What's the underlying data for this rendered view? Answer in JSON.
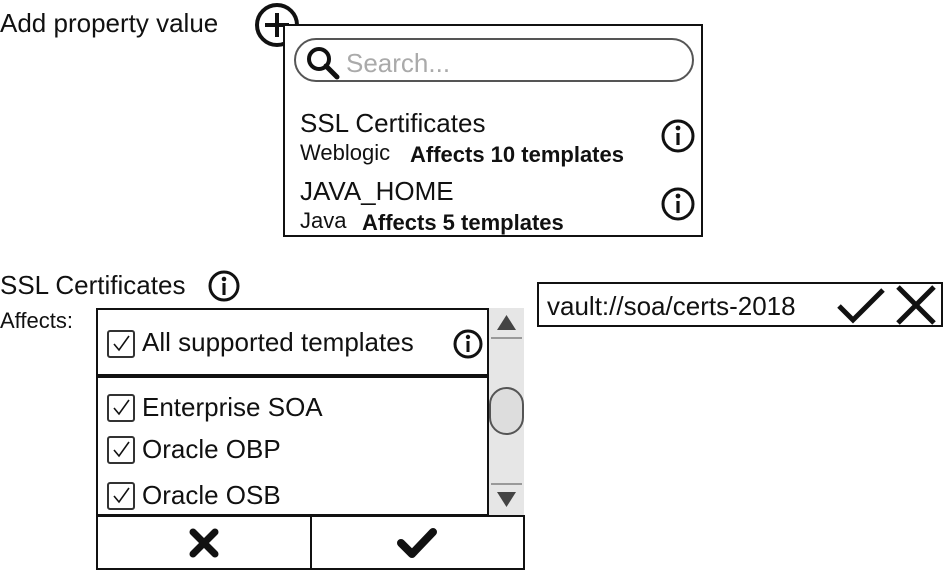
{
  "add_property": {
    "label": "Add property value"
  },
  "dropdown": {
    "search_placeholder": "Search...",
    "items": [
      {
        "name": "SSL Certificates",
        "category": "Weblogic",
        "affects": "Affects 10 templates"
      },
      {
        "name": "JAVA_HOME",
        "category": "Java",
        "affects": "Affects 5 templates"
      }
    ]
  },
  "editor": {
    "title": "SSL Certificates",
    "affects_label": "Affects:",
    "all_label": "All supported templates",
    "templates": [
      {
        "label": "Enterprise SOA",
        "checked": true
      },
      {
        "label": "Oracle OBP",
        "checked": true
      },
      {
        "label": "Oracle OSB",
        "checked": true
      }
    ],
    "value": "vault://soa/certs-2018"
  },
  "icons": {
    "add": "plus-circle-icon",
    "search": "search-icon",
    "info": "info-icon",
    "confirm": "check-icon",
    "cancel": "close-icon"
  }
}
